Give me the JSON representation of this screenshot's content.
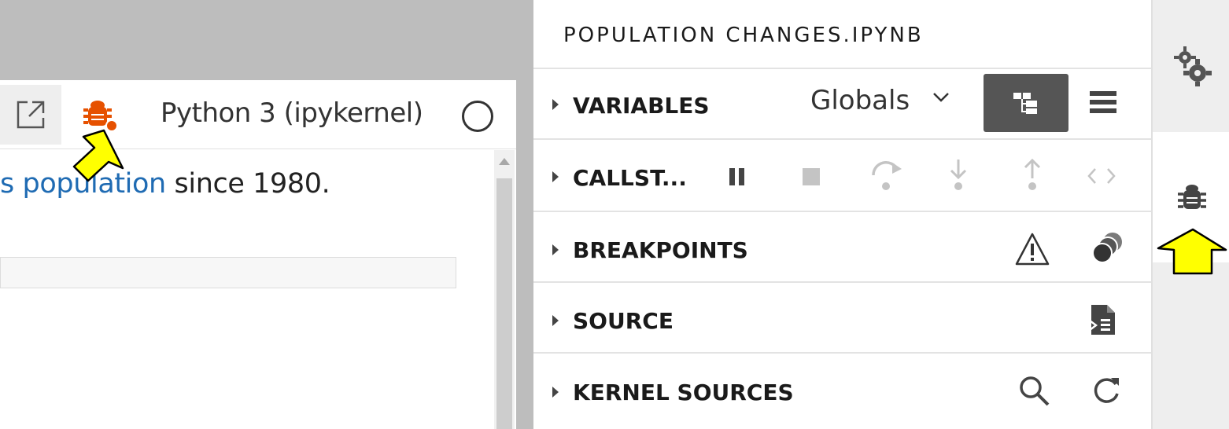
{
  "notebook": {
    "kernel_name": "Python 3 (ipykernel)",
    "text_before_link": "",
    "link_text": "s population",
    "text_after_link": " since 1980."
  },
  "debugger": {
    "title": "POPULATION CHANGES.IPYNB",
    "sections": {
      "variables": {
        "label": "VARIABLES",
        "scope": "Globals"
      },
      "callstack": {
        "label": "CALLST..."
      },
      "breakpoints": {
        "label": "BREAKPOINTS"
      },
      "source": {
        "label": "SOURCE"
      },
      "kernel_sources": {
        "label": "KERNEL SOURCES"
      }
    }
  },
  "icons": {
    "open_external": "external-link-icon",
    "debugger_toolbar": "bug-icon",
    "kernel_status": "circle-idle-icon",
    "tree_view": "tree-view-icon",
    "table_view": "table-view-icon",
    "pause": "pause-icon",
    "stop": "stop-icon",
    "step_over": "step-over-icon",
    "step_in": "step-in-icon",
    "step_out": "step-out-icon",
    "evaluate": "code-icon",
    "pause_on_exceptions": "warning-icon",
    "remove_breakpoints": "stacked-circles-icon",
    "open_source": "source-file-icon",
    "search": "search-icon",
    "refresh": "refresh-icon",
    "settings": "gears-icon",
    "debugger_sidebar": "bug-icon"
  },
  "colors": {
    "bug_accent": "#e65100",
    "link": "#1f6bb3",
    "annotation_arrow": "#ffff00"
  }
}
